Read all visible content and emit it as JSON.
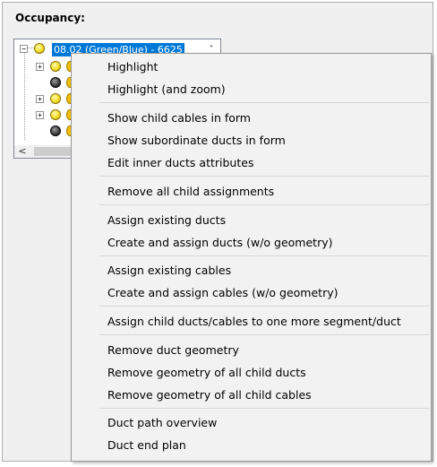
{
  "panel": {
    "title": "Occupancy:"
  },
  "tree": {
    "selected_label": "08.02 (Green/Blue) - 6625",
    "expander_minus": "−",
    "expander_plus": "+",
    "scroll_up": "˄",
    "scroll_left": "<"
  },
  "menu": {
    "items": [
      "Highlight",
      "Highlight (and zoom)",
      "Show child cables in form",
      "Show subordinate ducts in form",
      "Edit inner ducts attributes",
      "Remove all child assignments",
      "Assign existing ducts",
      "Create and assign ducts (w/o geometry)",
      "Assign existing cables",
      "Create and assign cables (w/o geometry)",
      "Assign child ducts/cables to one more segment/duct",
      "Remove duct geometry",
      "Remove geometry of all child ducts",
      "Remove geometry of all child cables",
      "Duct path overview",
      "Duct end plan"
    ]
  },
  "colors": {
    "selection": "#0078d7",
    "node_yellow": "#f5de2a",
    "node_dark": "#3a3a3a"
  }
}
